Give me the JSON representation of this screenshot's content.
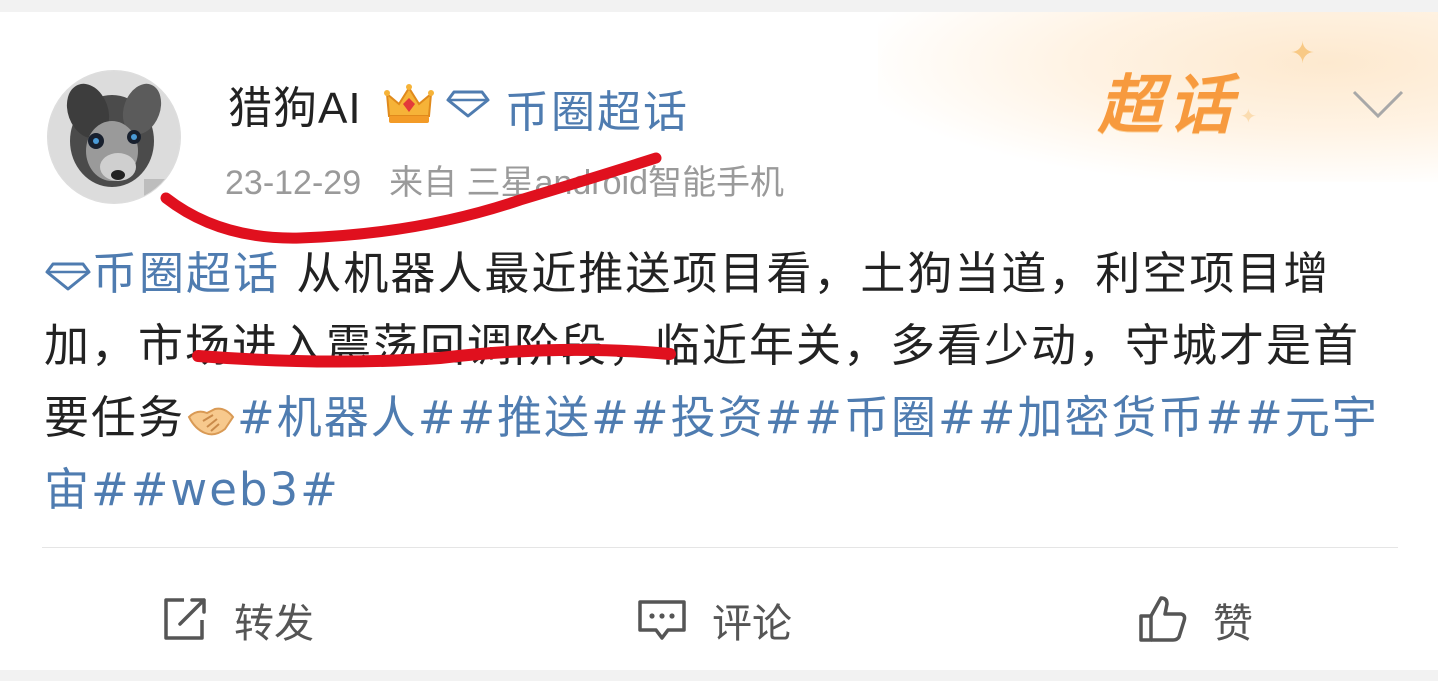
{
  "author": {
    "name": "猎狗AI",
    "supertopic_name": "币圈超话"
  },
  "meta": {
    "date": "23-12-29",
    "source": "来自 三星android智能手机"
  },
  "badge": {
    "text": "超话"
  },
  "post": {
    "topic_link": "币圈超话",
    "segments": [
      {
        "text": " 从机器人最近推送项目看，土狗当道，利空项目增加，",
        "type": "plain"
      },
      {
        "text": "市场进入震荡回调阶段",
        "type": "plain"
      },
      {
        "text": "，临近年关，多看少动，守城才是首要任务",
        "type": "plain"
      }
    ],
    "emoji": "handshake-emoji",
    "hashtags": [
      "#机器人#",
      "#推送#",
      "#投资#",
      "#币圈#",
      "#加密货币#",
      "#元宇宙#",
      "#web3#"
    ]
  },
  "actions": {
    "repost_label": "转发",
    "comment_label": "评论",
    "like_label": "赞"
  },
  "colors": {
    "link": "#4f7cb0",
    "annotation": "#e0101e",
    "brand": "#f79a3e"
  }
}
